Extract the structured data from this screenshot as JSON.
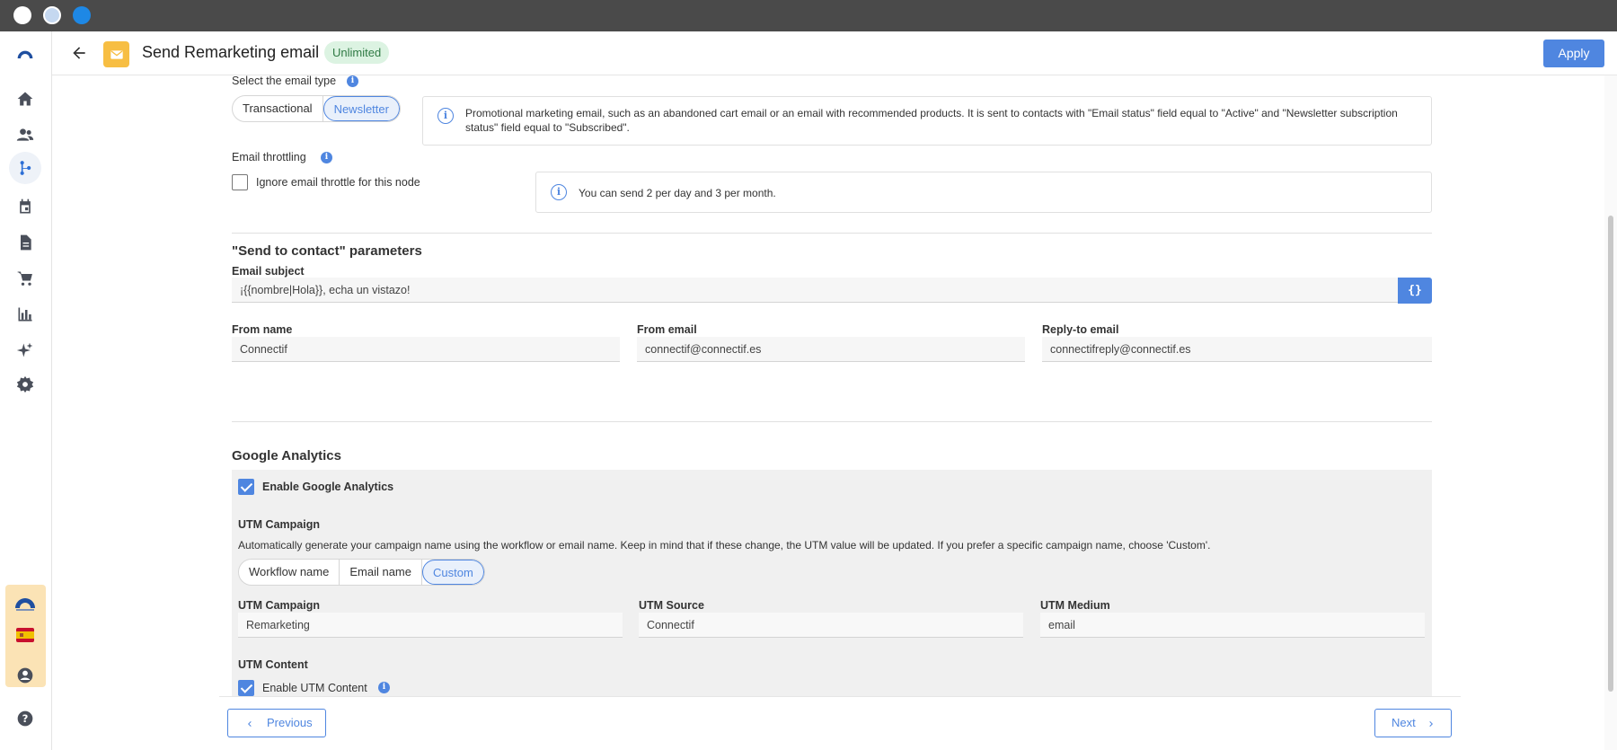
{
  "header": {
    "title": "Send Remarketing email",
    "badge": "Unlimited",
    "apply_label": "Apply"
  },
  "email_type": {
    "label": "Select the email type",
    "options": [
      "Transactional",
      "Newsletter"
    ],
    "selected": "Newsletter",
    "info_text": "Promotional marketing email, such as an abandoned cart email or an email with recommended products. It is sent to contacts with \"Email status\" field equal to \"Active\" and \"Newsletter subscription status\" field equal to \"Subscribed\"."
  },
  "throttling": {
    "label": "Email throttling",
    "checkbox_label": "Ignore email throttle for this node",
    "checked": false,
    "info_text": "You can send 2 per day and 3 per month."
  },
  "send_params": {
    "heading": "\"Send to contact\" parameters",
    "subject_label": "Email subject",
    "subject_value": "¡{{nombre|Hola}}, echa un vistazo!",
    "var_button": "{}",
    "from_name_label": "From name",
    "from_name_value": "Connectif",
    "from_email_label": "From email",
    "from_email_value": "connectif@connectif.es",
    "reply_to_label": "Reply-to email",
    "reply_to_value": "connectifreply@connectif.es"
  },
  "google_analytics": {
    "heading": "Google Analytics",
    "enable_label": "Enable Google Analytics",
    "enabled": true,
    "utm_campaign_heading": "UTM Campaign",
    "utm_campaign_desc": "Automatically generate your campaign name using the workflow or email name. Keep in mind that if these change, the UTM value will be updated. If you prefer a specific campaign name, choose 'Custom'.",
    "campaign_options": [
      "Workflow name",
      "Email name",
      "Custom"
    ],
    "campaign_selected": "Custom",
    "utm_campaign_label": "UTM Campaign",
    "utm_campaign_value": "Remarketing",
    "utm_source_label": "UTM Source",
    "utm_source_value": "Connectif",
    "utm_medium_label": "UTM Medium",
    "utm_medium_value": "email",
    "utm_content_heading": "UTM Content",
    "utm_content_enable_label": "Enable UTM Content",
    "utm_content_enabled": true
  },
  "footer": {
    "previous_label": "Previous",
    "next_label": "Next"
  },
  "colors": {
    "accent": "#4f86e0",
    "badge_bg": "#dcf3e2",
    "mail_icon_bg": "#f7be43",
    "promo_bg": "#fbe3b5"
  }
}
